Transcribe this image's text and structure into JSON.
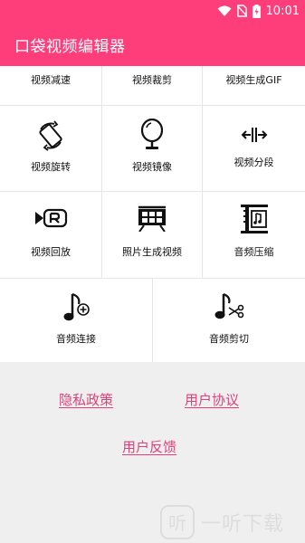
{
  "status_bar": {
    "time": "10:01",
    "background": "#fe3e7b",
    "icons": [
      "wifi-icon",
      "no-sim-icon",
      "battery-charging-icon"
    ]
  },
  "app_bar": {
    "title": "口袋视频编辑器",
    "background": "#fe3e7b"
  },
  "tools": [
    {
      "label": "视频减速",
      "icon": "video-slow-icon"
    },
    {
      "label": "视频裁剪",
      "icon": "video-crop-icon"
    },
    {
      "label": "视频生成GIF",
      "icon": "video-to-gif-icon"
    },
    {
      "label": "视频旋转",
      "icon": "rotate-icon"
    },
    {
      "label": "视频镜像",
      "icon": "mirror-icon"
    },
    {
      "label": "视频分段",
      "icon": "split-icon"
    },
    {
      "label": "视频回放",
      "icon": "replay-icon"
    },
    {
      "label": "照片生成视频",
      "icon": "photo-to-video-icon"
    },
    {
      "label": "音频压缩",
      "icon": "audio-compress-icon"
    },
    {
      "label": "音频连接",
      "icon": "audio-join-icon"
    },
    {
      "label": "音频剪切",
      "icon": "audio-cut-icon"
    }
  ],
  "footer_links": {
    "privacy": "隐私政策",
    "agreement": "用户协议",
    "feedback": "用户反馈",
    "color": "#e0417a"
  },
  "watermark": {
    "icon_char": "听",
    "text": "一听下载"
  }
}
